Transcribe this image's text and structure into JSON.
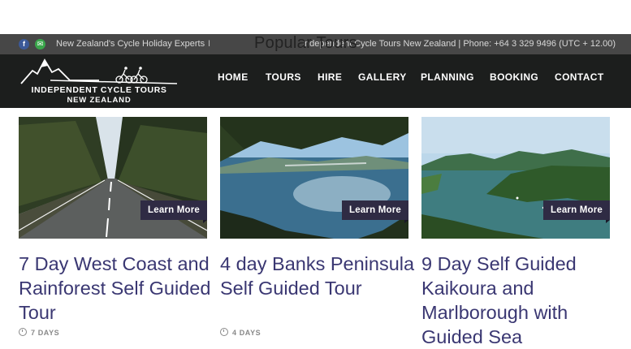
{
  "topbar": {
    "facebook_icon": "facebook-icon",
    "email_icon": "email-icon",
    "tagline": "New Zealand's Cycle Holiday Experts",
    "separator": "I",
    "contact": "Independent Cycle Tours New Zealand | Phone: +64 3 329 9496 (UTC + 12.00)"
  },
  "section_title": "Popular Tours",
  "logo": {
    "line1": "INDEPENDENT CYCLE TOURS",
    "line2": "NEW ZEALAND"
  },
  "nav": {
    "items": [
      "HOME",
      "TOURS",
      "HIRE",
      "GALLERY",
      "PLANNING",
      "BOOKING",
      "CONTACT"
    ]
  },
  "tours": [
    {
      "title": "7 Day West Coast and Rainforest Self Guided Tour",
      "duration": "7 DAYS",
      "button": "Learn More",
      "image": "forest-road-photo"
    },
    {
      "title": "4 day Banks Peninsula Self Guided Tour",
      "duration": "4 DAYS",
      "button": "Learn More",
      "image": "lake-jetty-photo"
    },
    {
      "title": "9 Day Self Guided Kaikoura and Marlborough with Guided Sea",
      "duration": "",
      "button": "Learn More",
      "image": "sounds-bay-photo"
    }
  ],
  "colors": {
    "topbar_bg": "#474747",
    "header_bg": "#1c1e1d",
    "title_text": "#3a3772",
    "button_bg": "#2f2b44"
  }
}
